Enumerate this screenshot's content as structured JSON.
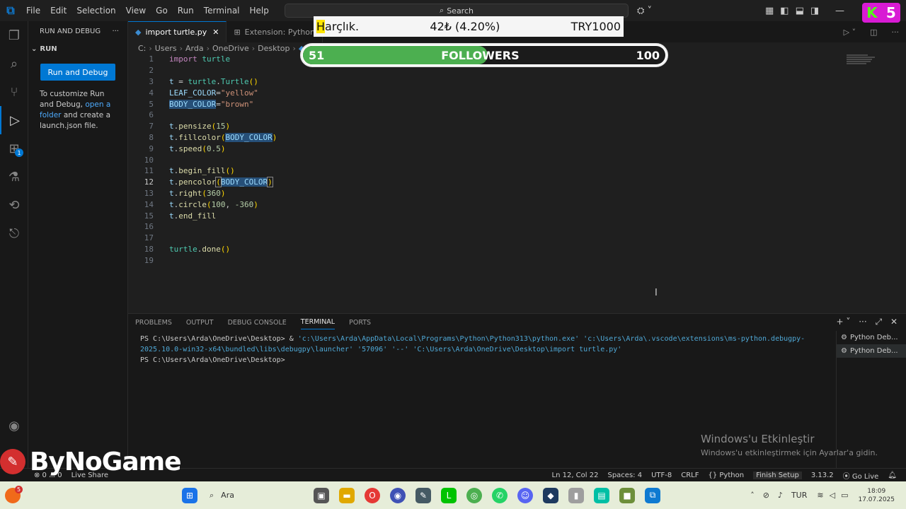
{
  "titlebar": {
    "logo": "vscode-logo",
    "menu": [
      "File",
      "Edit",
      "Selection",
      "View",
      "Go",
      "Run",
      "Terminal",
      "Help"
    ],
    "search_placeholder": "Search"
  },
  "sidebar": {
    "header": "RUN AND DEBUG",
    "more": "···",
    "section": "RUN",
    "run_button": "Run and Debug",
    "text_before_link": "To customize Run and Debug, ",
    "link": "open a folder",
    "text_after_link": " and create a launch.json file."
  },
  "activity": {
    "extensions_badge": "1"
  },
  "tabs": [
    {
      "label": "import turtle.py",
      "active": true
    },
    {
      "label": "Extension: Python",
      "active": false
    }
  ],
  "breadcrumb": [
    "C:",
    "Users",
    "Arda",
    "OneDrive",
    "Desktop"
  ],
  "editor": {
    "current_line": 12,
    "lines": [
      {
        "n": "1",
        "t": "import turtle"
      },
      {
        "n": "2",
        "t": ""
      },
      {
        "n": "3",
        "t": "t = turtle.Turtle()"
      },
      {
        "n": "4",
        "t": "LEAF_COLOR=\"yellow\""
      },
      {
        "n": "5",
        "t": "BODY_COLOR=\"brown\""
      },
      {
        "n": "6",
        "t": ""
      },
      {
        "n": "7",
        "t": "t.pensize(15)"
      },
      {
        "n": "8",
        "t": "t.fillcolor(BODY_COLOR)"
      },
      {
        "n": "9",
        "t": "t.speed(0.5)"
      },
      {
        "n": "10",
        "t": ""
      },
      {
        "n": "11",
        "t": "t.begin_fill()"
      },
      {
        "n": "12",
        "t": "t.pencolor(BODY_COLOR)"
      },
      {
        "n": "13",
        "t": "t.right(360)"
      },
      {
        "n": "14",
        "t": "t.circle(100, -360)"
      },
      {
        "n": "15",
        "t": "t.end_fill"
      },
      {
        "n": "16",
        "t": ""
      },
      {
        "n": "17",
        "t": ""
      },
      {
        "n": "18",
        "t": "turtle.done()"
      },
      {
        "n": "19",
        "t": ""
      }
    ]
  },
  "panel": {
    "tabs": [
      "PROBLEMS",
      "OUTPUT",
      "DEBUG CONSOLE",
      "TERMINAL",
      "PORTS"
    ],
    "active_tab": "TERMINAL",
    "terminal": {
      "prompt1": "PS C:\\Users\\Arda\\OneDrive\\Desktop> ",
      "cmd_amp": "& ",
      "cmd_str1": "'c:\\Users\\Arda\\AppData\\Local\\Programs\\Python\\Python313\\python.exe' 'c:\\Users\\Arda\\.vscode\\extensions\\ms-python.debugpy-2025.10.0-win32-x64\\bundled\\libs\\debugpy\\launcher' '57096' '--' 'C:\\Users\\Arda\\OneDrive\\Desktop\\import turtle.py'",
      "prompt2": "PS C:\\Users\\Arda\\OneDrive\\Desktop>"
    },
    "terminal_list": [
      "Python Deb...",
      "Python Deb..."
    ]
  },
  "statusbar": {
    "errors": "⊗ 0 ⚠ 0",
    "live_share": "Live Share",
    "position": "Ln 12, Col 22",
    "spaces": "Spaces: 4",
    "encoding": "UTF-8",
    "eol": "CRLF",
    "language": "Python",
    "finish_setup": "Finish Setup",
    "python_version": "3.13.2",
    "go_live": "Go Live"
  },
  "watermark": {
    "title": "Windows'u Etkinleştir",
    "subtitle": "Windows'u etkinleştirmek için Ayarlar'a gidin."
  },
  "overlay": {
    "harclik_first": "H",
    "harclik_rest": "arçlık.",
    "harclik_amount": "42₺ (4.20%)",
    "harclik_goal": "TRY1000",
    "followers_current": "51",
    "followers_label": "FOLLOWERS",
    "followers_goal": "100",
    "followers_progress": 0.51,
    "kick_letter": "K",
    "kick_number": "5",
    "bynogame": "ByNoGame"
  },
  "taskbar": {
    "search": "Ara",
    "lang": "TUR",
    "time": "18:09",
    "date": "17.07.2025",
    "notif_badge": "5"
  },
  "colors": {
    "accent": "#0078d4",
    "followers_fill": "#4caf50",
    "kick_bg": "#d81bd4",
    "kick_k": "#53fc18"
  }
}
